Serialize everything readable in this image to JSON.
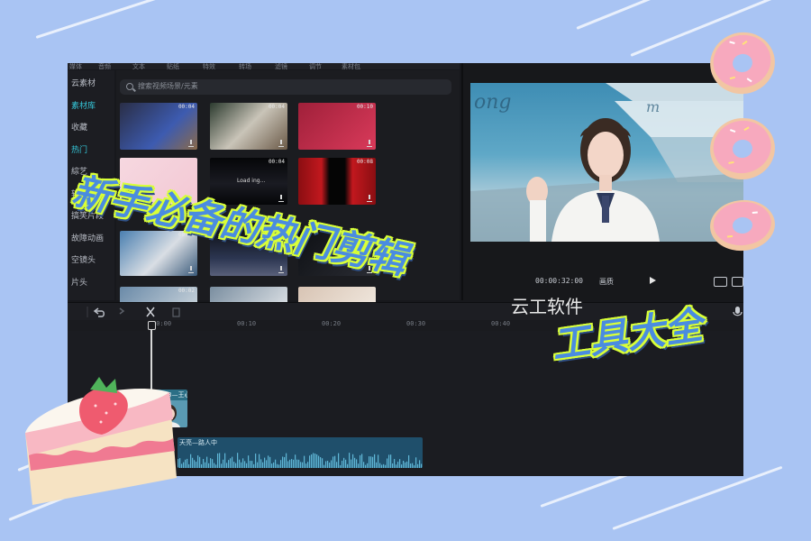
{
  "colors": {
    "background": "#a9c4f3",
    "editor_bg": "#17181c",
    "accent": "#35c6d8",
    "headline_fill": "#4a8ce0",
    "headline_outline": "#d9ff38"
  },
  "editor": {
    "top_nav": [
      "媒体",
      "音频",
      "文本",
      "贴纸",
      "特效",
      "转场",
      "滤镜",
      "调节",
      "素材包"
    ],
    "sidebar": {
      "items": [
        {
          "label": "云素材",
          "active": false
        },
        {
          "label": "素材库",
          "active": true
        },
        {
          "label": "收藏",
          "active": false
        },
        {
          "label": "热门",
          "active": true
        },
        {
          "label": "綜艺",
          "active": false
        },
        {
          "label": "转场",
          "active": false
        },
        {
          "label": "搞笑片段",
          "active": false
        },
        {
          "label": "故障动画",
          "active": false
        },
        {
          "label": "空镜头",
          "active": false
        },
        {
          "label": "片头",
          "active": false
        }
      ]
    },
    "search": {
      "placeholder": "搜索视频场景/元素",
      "icon": "search-icon"
    },
    "thumbnails": [
      {
        "duration": "00:04",
        "label": ""
      },
      {
        "duration": "00:04",
        "label": ""
      },
      {
        "duration": "00:10",
        "label": ""
      },
      {
        "duration": "",
        "label": "綜艺"
      },
      {
        "duration": "00:04",
        "label": ""
      },
      {
        "duration": "00:08",
        "label": ""
      },
      {
        "duration": "00:04",
        "label": ""
      },
      {
        "duration": "",
        "label": ""
      },
      {
        "duration": "",
        "label": ""
      },
      {
        "duration": "00:02",
        "label": ""
      },
      {
        "duration": "",
        "label": ""
      },
      {
        "duration": "",
        "label": ""
      }
    ],
    "thumbnail_overlay_text": "Load ing...",
    "player": {
      "timecode": "00:00:32:00",
      "quality_label": "画质"
    },
    "ruler_ticks": [
      "00:00",
      "00:10",
      "00:20",
      "00:30",
      "00:40"
    ],
    "video_clip_label": "浪姐3—王心",
    "audio_clip_label": "天亮—路人中"
  },
  "overlay": {
    "headline_line1": "新手必备的热门剪辑",
    "headline_line2": "工具大全",
    "watermark": "云工软件"
  }
}
